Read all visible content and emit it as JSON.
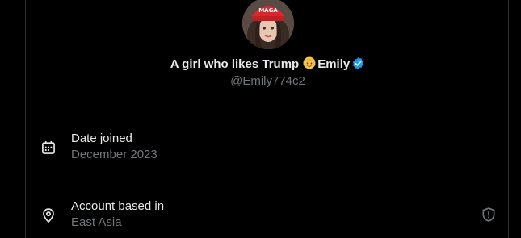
{
  "profile": {
    "display_name": "A girl who likes Trump",
    "name_suffix": "Emily",
    "name_emoji": "person-emoji",
    "verified_icon": "verified-badge-icon",
    "handle": "@Emily774c2",
    "avatar_hat_text": "MAGA"
  },
  "details": {
    "joined": {
      "icon": "calendar-icon",
      "label": "Date joined",
      "value": "December 2023"
    },
    "location": {
      "icon": "location-pin-icon",
      "label": "Account based in",
      "value": "East Asia"
    },
    "privacy_icon": "shield-icon"
  },
  "colors": {
    "background": "#000000",
    "primary_text": "#e7e9ea",
    "secondary_text": "#71767b",
    "verified_blue": "#1d9bf0",
    "border": "#2f3336"
  }
}
